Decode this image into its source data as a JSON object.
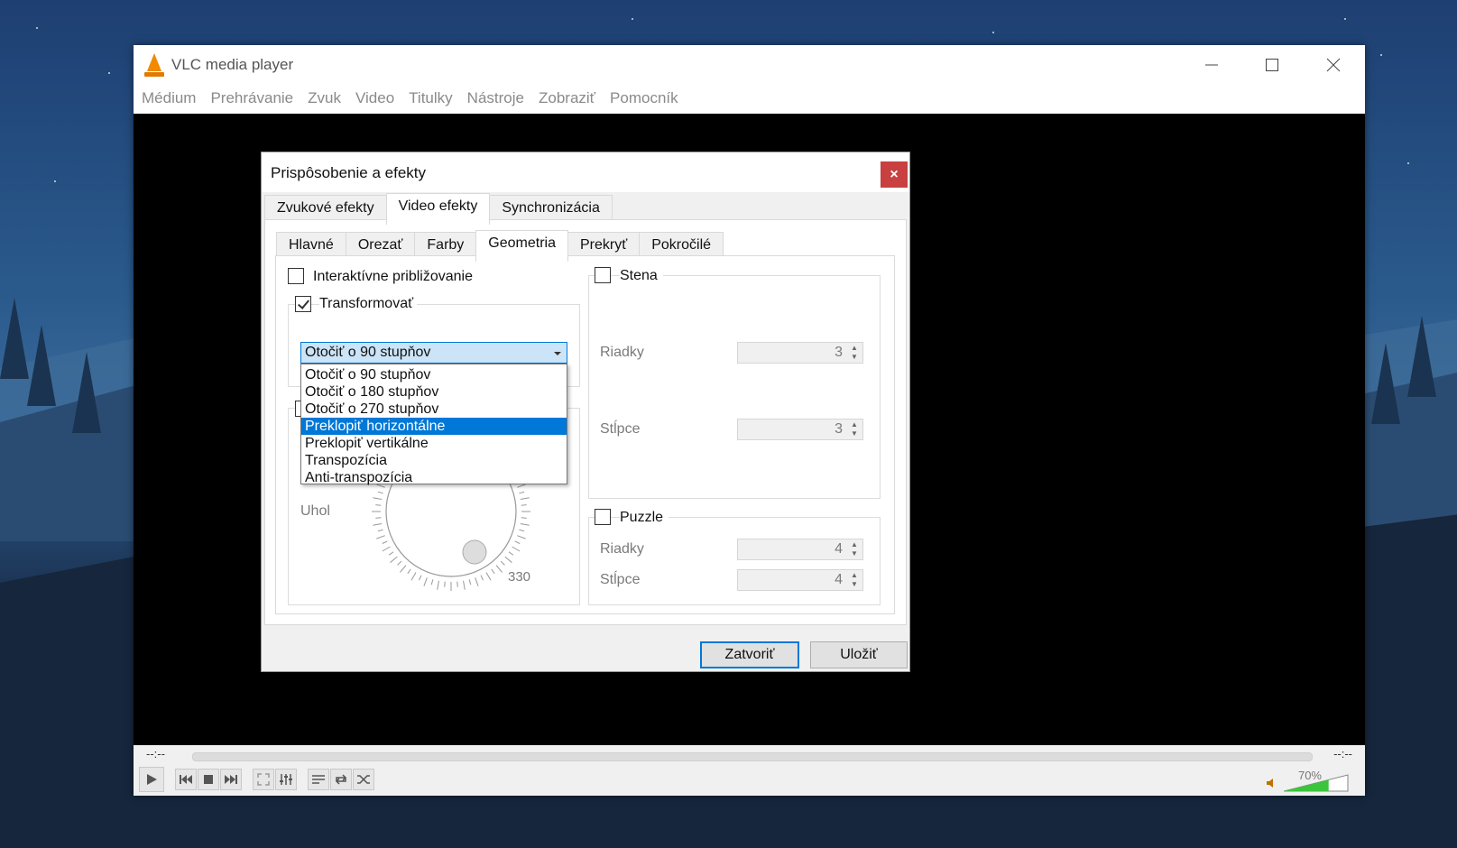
{
  "app": {
    "title": "VLC media player",
    "menu": [
      "Médium",
      "Prehrávanie",
      "Zvuk",
      "Video",
      "Titulky",
      "Nástroje",
      "Zobraziť",
      "Pomocník"
    ]
  },
  "player": {
    "time_elapsed": "--:--",
    "time_total": "--:--",
    "volume_label": "70%",
    "volume_level": 0.7
  },
  "dialog": {
    "title": "Prispôsobenie a efekty",
    "close_glyph": "×",
    "tabs": [
      "Zvukové efekty",
      "Video efekty",
      "Synchronizácia"
    ],
    "active_tab": "Video efekty",
    "subtabs": [
      "Hlavné",
      "Orezať",
      "Farby",
      "Geometria",
      "Prekryť",
      "Pokročilé"
    ],
    "active_subtab": "Geometria",
    "interactive_zoom_label": "Interaktívne približovanie",
    "interactive_zoom_checked": false,
    "transform_label": "Transformovať",
    "transform_checked": true,
    "transform_selected": "Otočiť o 90 stupňov",
    "transform_options": [
      "Otočiť o 90 stupňov",
      "Otočiť o 180 stupňov",
      "Otočiť o 270 stupňov",
      "Preklopiť horizontálne",
      "Preklopiť vertikálne",
      "Transpozícia",
      "Anti-transpozícia"
    ],
    "highlighted_option": "Preklopiť horizontálne",
    "angle_label": "Uhol",
    "angle_value": "330",
    "wall": {
      "label": "Stena",
      "checked": false,
      "rows_label": "Riadky",
      "rows_value": "3",
      "cols_label": "Stĺpce",
      "cols_value": "3"
    },
    "puzzle": {
      "label": "Puzzle",
      "checked": false,
      "rows_label": "Riadky",
      "rows_value": "4",
      "cols_label": "Stĺpce",
      "cols_value": "4"
    },
    "close_button": "Zatvoriť",
    "save_button": "Uložiť"
  },
  "colors": {
    "accent": "#0078d7",
    "close_red": "#c84040",
    "vlc_orange": "#f08a00",
    "volume_green": "#3cc43c"
  }
}
